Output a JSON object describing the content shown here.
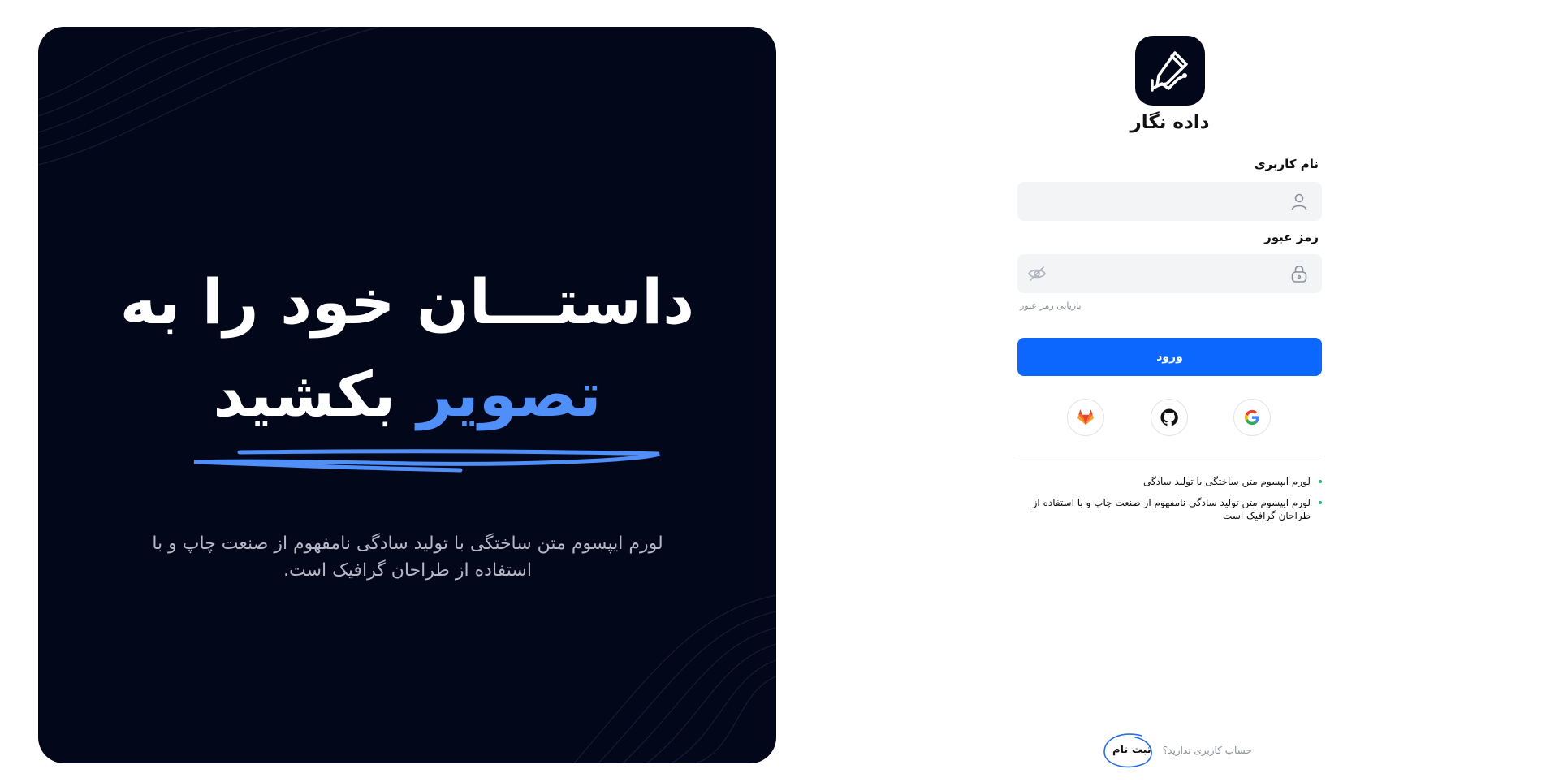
{
  "hero": {
    "title_line1": "داستـــان خود را به",
    "title_accent": "تصویر",
    "title_line2_rest": "بکشید",
    "description": "لورم ایپسوم متن ساختگی با تولید سادگی نامفهوم از صنعت چاپ و با استفاده از طراحان گرافیک است.",
    "accent_color": "#4f8ff7",
    "background_color": "#03071a"
  },
  "brand": {
    "name": "داده نگار",
    "logo_icon": "pen-chart-icon"
  },
  "form": {
    "username_label": "نام کاربری",
    "username_value": "",
    "username_icon": "user-icon",
    "password_label": "رمز عبور",
    "password_value": "",
    "password_icon": "lock-icon",
    "password_toggle_icon": "eye-off-icon",
    "forgot_password": "بازیابی رمز عبور",
    "login_button": "ورود",
    "button_color": "#0b67fe"
  },
  "social_logins": [
    {
      "name": "google",
      "icon": "google-icon"
    },
    {
      "name": "github",
      "icon": "github-icon"
    },
    {
      "name": "gitlab",
      "icon": "gitlab-icon"
    }
  ],
  "features": [
    "لورم ایپسوم متن ساختگی با تولید سادگی",
    "لورم ایپسوم متن تولید سادگی نامفهوم از صنعت چاپ و با استفاده از طراحان گرافیک است"
  ],
  "signup": {
    "question": "حساب کاربری ندارید؟",
    "link": "ثبت نام"
  }
}
